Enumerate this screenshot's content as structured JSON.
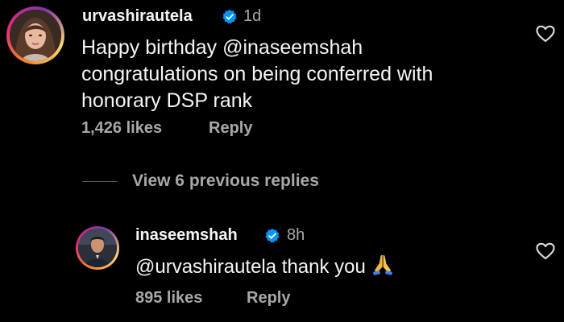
{
  "comments": [
    {
      "username": "urvashirautela",
      "time": "1d",
      "lines": [
        "Happy birthday @inaseemshah",
        "congratulations on being conferred with",
        "honorary DSP rank"
      ],
      "likes": "1,426 likes",
      "reply_label": "Reply"
    },
    {
      "username": "inaseemshah",
      "time": "8h",
      "text": "@urvashirautela thank you",
      "likes": "895 likes",
      "reply_label": "Reply"
    }
  ],
  "view_replies": "View 6 previous replies",
  "icons": {
    "verified": "verified-badge-icon",
    "like": "heart-icon",
    "emoji": "folded-hands-emoji"
  },
  "colors": {
    "background": "#000000",
    "text": "#f5f5f5",
    "muted": "#a8a8a8",
    "verified": "#0095f6"
  }
}
